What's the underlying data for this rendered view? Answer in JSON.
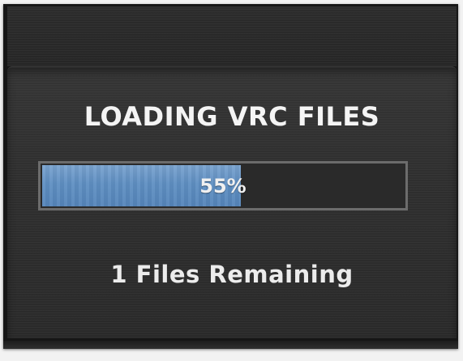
{
  "dialog": {
    "title": "LOADING VRC FILES",
    "progress": {
      "percent": 55,
      "label": "55%",
      "fill_color": "#5f8fc2"
    },
    "status_text": "1 Files Remaining"
  }
}
